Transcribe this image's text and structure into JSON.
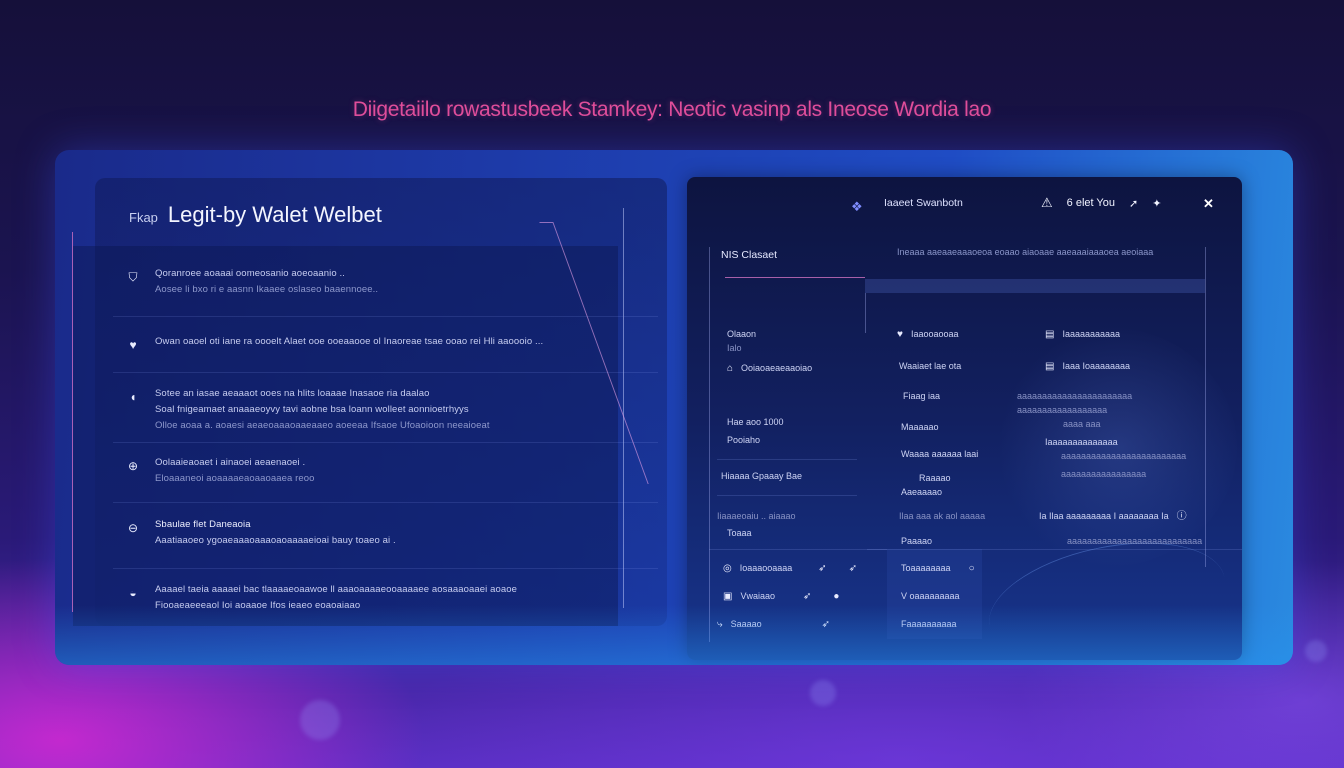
{
  "headline": "Diigetaiilo rowastusbeek Stamkey: Neotic vasinp als Ineose Wordia lao",
  "left_panel": {
    "tag": "Fkap",
    "title": "Legit-by Walet Welbet",
    "features": [
      {
        "icon": "shield-icon",
        "glyph": "⛉",
        "lines": [
          "Qoranroee aoaaai oomeosanio aoeoaanio ..",
          "Aosee li bxo ri e aasnn Ikaaee oslaseo baaennoee.."
        ]
      },
      {
        "icon": "heart-icon",
        "glyph": "♥",
        "lines": [
          "Owan oaoel oti iane ra oooelt Alaet ooe ooeaaooe ol Inaoreae tsae ooao rei Hli aaoooio ..."
        ]
      },
      {
        "icon": "lock-icon",
        "glyph": "◖",
        "lines": [
          "Sotee an iasae aeaaaot ooes na hlits loaaae Inasaoe ria daalao",
          "Soal fnigeamaet anaaaeoyvy tavi aobne bsa loann wolleet aonnioetrhyys",
          "Olloe aoaa a. aoaesi aeaeoaaaoaaeaaeo aoeeaa Ifsaoe Ufoaoioon neeaioeat"
        ]
      },
      {
        "icon": "globe-icon",
        "glyph": "⊕",
        "lines": [
          "Oolaaieaoaet i ainaoei aeaenaoei .",
          "Eloaaaneoi aoaaaaeaoaaoaaea reoo"
        ]
      },
      {
        "icon": "link-icon",
        "glyph": "⊖",
        "lines": [
          "Sbaulae flet Daneaoia",
          "Aaatiaaoeo ygoaeaaaoaaaoaoaaaaeioai bauy toaeo ai ."
        ]
      },
      {
        "icon": "coin-icon",
        "glyph": "◒",
        "lines": [
          "Aaaael taeia aaaaei bac tlaaaaeoaawoe ll aaaoaaaaeooaaaaee aosaaaoaaei aoaoe",
          "Fiooaeaeeeaol Ioi aoaaoe Ifos ieaeo eoaoaiaao"
        ]
      }
    ]
  },
  "right_panel": {
    "brand": "Iaaeet Swanbotn",
    "user_label": "6 elet You",
    "close_label": "✕",
    "section_title": "NIS Clasaet",
    "section_sub": "Ineaaa aaeaaeaaaoeoa eoaao aiaoaae aaeaaaiaaaoea aeoiaaa",
    "col1": [
      "Olaaon",
      "Ialo",
      "Ooiaoaeaeaaoiao",
      "Hae aoo 1000",
      "Pooiaho",
      "Hiaaaa Gpaaay Bae",
      "Iiaaaeoaiu .. aiaaao",
      "Toaaa",
      "Ioaaaooaaaa",
      "Vwaiaao",
      "Saaaao"
    ],
    "col2": [
      "Iaaooaooaa",
      "Waaiaet lae ota",
      "Fiaag iaa",
      "Maaaaao",
      "Waaaa aaaaaa laai",
      "Raaaao",
      "Aaeaaaao",
      "Ilaa aaa ak aol aaaaa",
      "Paaaao",
      "Toaaaaaaaa",
      "V oaaaaaaaaa",
      "Faaaaaaaaaa"
    ],
    "col3": [
      "Iaaaaaaaaaaa",
      "Iaaa Ioaaaaaaaa",
      "aaaaaaaaaaaaaaaaaaaaaaa",
      "aaaaaaaaaaaaaaaaaa",
      "aaaa aaa",
      "Iaaaaaaaaaaaaaa",
      "aaaaaaaaaaaaaaaaaaaaaaaaa",
      "aaaaaaaaaaaaaaaaa",
      "Ia Ilaa aaaaaaaaa I aaaaaaaa Ia",
      "aaaaaaaaaaaaaaaaaaaaaaaaaaa"
    ]
  }
}
